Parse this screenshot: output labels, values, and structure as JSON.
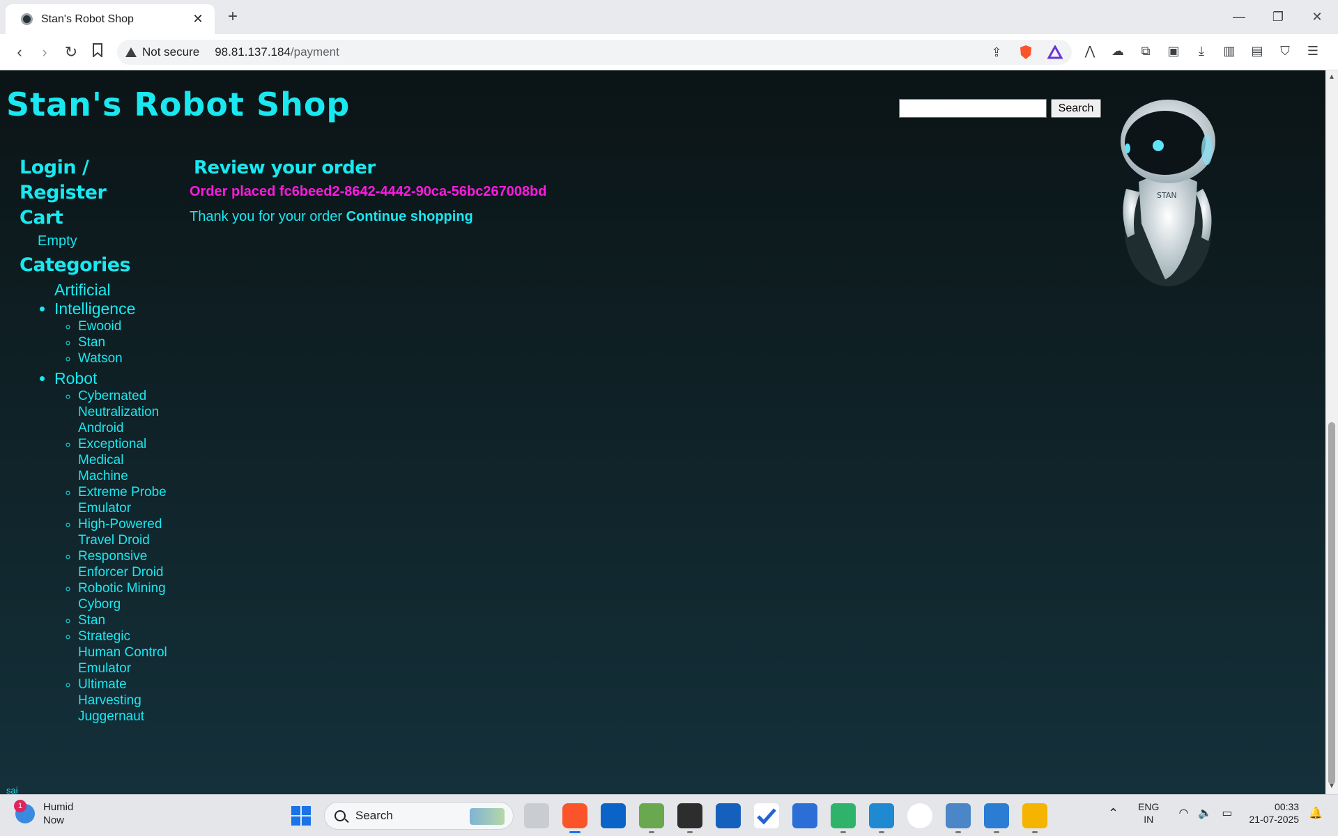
{
  "browser": {
    "tab_title": "Stan's Robot Shop",
    "tab_close": "✕",
    "new_tab": "+",
    "security_label": "Not secure",
    "url_host": "98.81.137.184",
    "url_path": "/payment",
    "window_controls": {
      "minimize": "—",
      "restore": "❐",
      "close": "✕"
    }
  },
  "site": {
    "title": "Stan's Robot Shop",
    "search": {
      "value": "",
      "placeholder": "",
      "button_label": "Search"
    }
  },
  "sidebar": {
    "login_label": "Login / Register",
    "cart_label": "Cart",
    "cart_status": "Empty",
    "categories_label": "Categories",
    "categories": [
      {
        "name": "Artificial Intelligence",
        "items": [
          "Ewooid",
          "Stan",
          "Watson"
        ]
      },
      {
        "name": "Robot",
        "items": [
          "Cybernated Neutralization Android",
          "Exceptional Medical Machine",
          "Extreme Probe Emulator",
          "High-Powered Travel Droid",
          "Responsive Enforcer Droid",
          "Robotic Mining Cyborg",
          "Stan",
          "Strategic Human Control Emulator",
          "Ultimate Harvesting Juggernaut"
        ]
      }
    ]
  },
  "main": {
    "heading": "Review your order",
    "order_placed": "Order placed fc6beed2-8642-4442-90ca-56bc267008bd",
    "thanks_text": "Thank you for your order",
    "continue_link": "Continue shopping"
  },
  "footer": {
    "user": "sai"
  },
  "robot": {
    "label": "STAN"
  },
  "taskbar": {
    "weather_title": "Humid",
    "weather_sub": "Now",
    "weather_badge": "1",
    "search_label": "Search",
    "lang_top": "ENG",
    "lang_bottom": "IN",
    "time": "00:33",
    "date": "21-07-2025"
  },
  "colors": {
    "accent": "#19e8f0",
    "order": "#ff1ae0",
    "background": "#0e1a1e"
  }
}
